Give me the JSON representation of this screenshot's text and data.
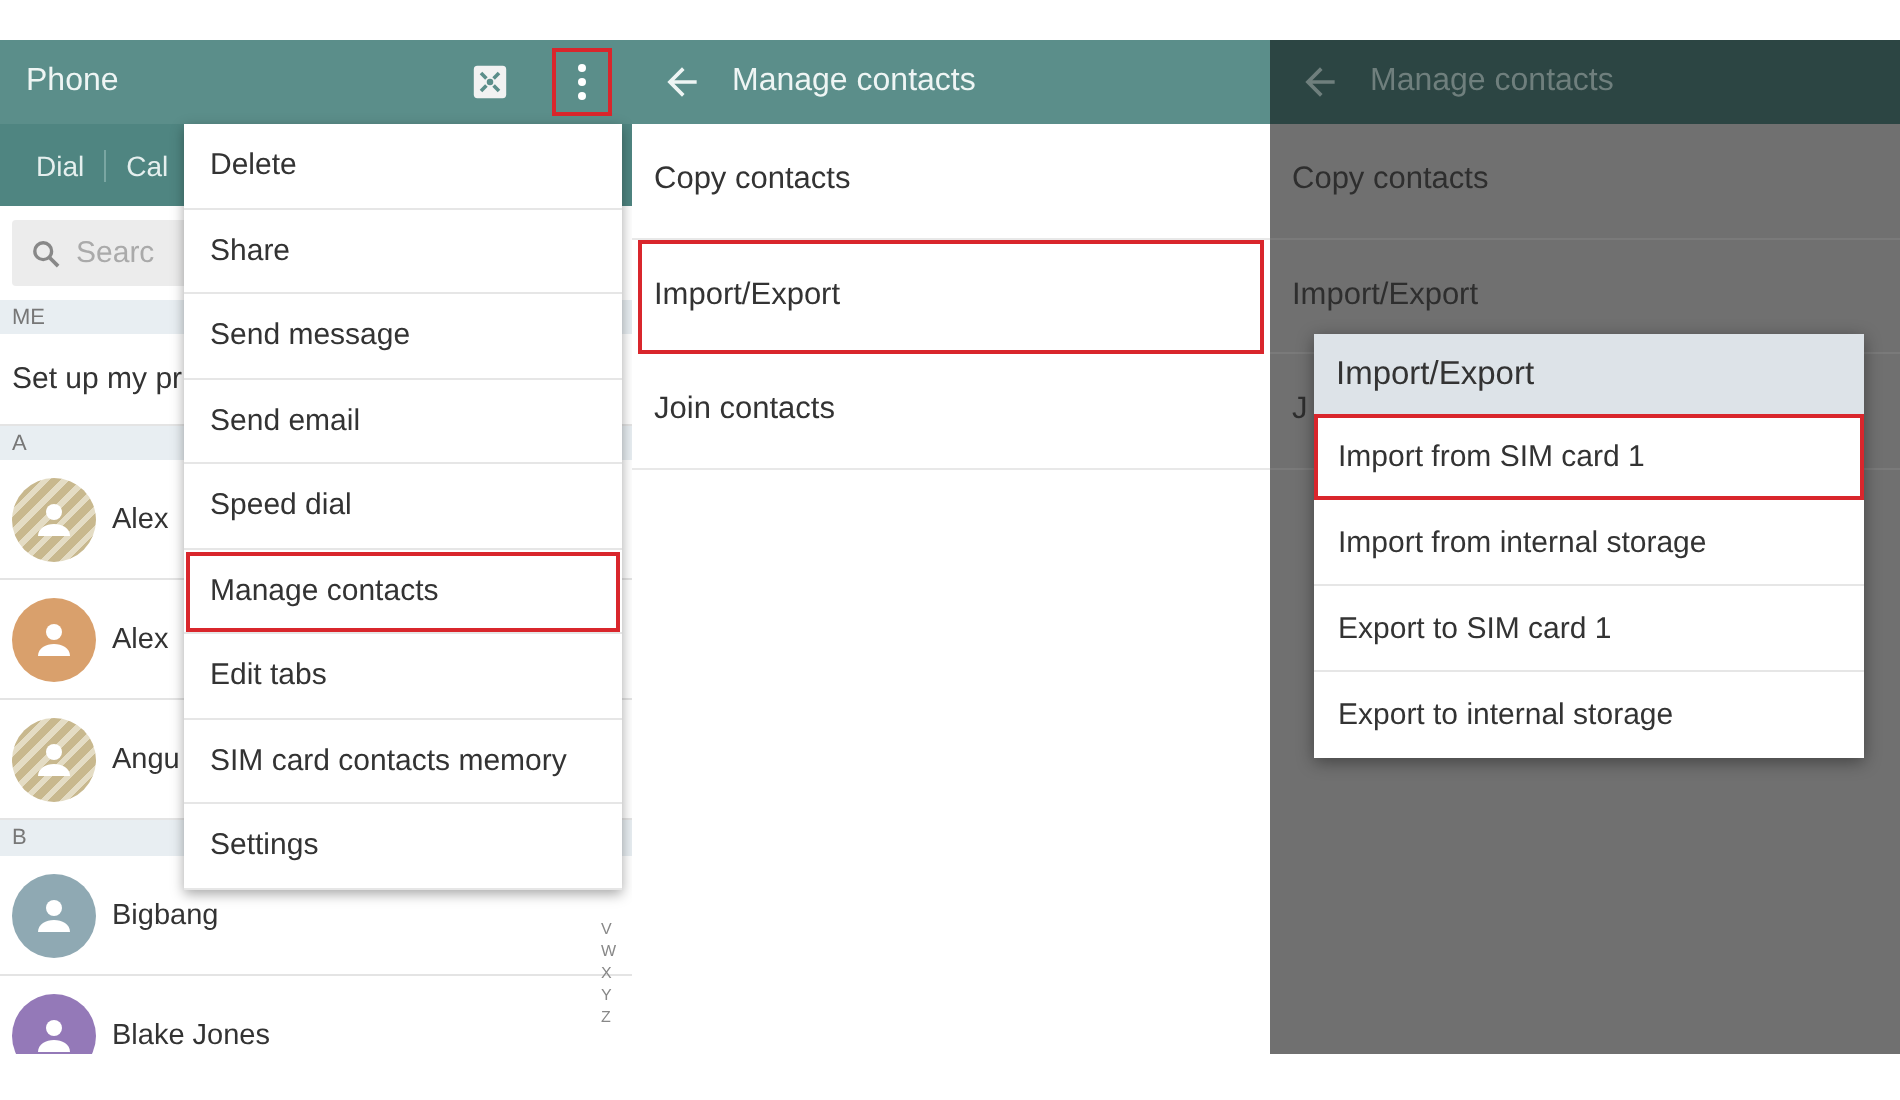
{
  "contacts_screen": {
    "title": "Phone",
    "more_button": {
      "selected": true
    },
    "tabs": [
      {
        "label": "Dial"
      },
      {
        "label": "Cal"
      }
    ],
    "search": {
      "placeholder": "Searc"
    },
    "sections": [
      {
        "header": "ME",
        "items": [
          {
            "kind": "profile",
            "name": "Set up my pr"
          }
        ]
      },
      {
        "header": "A",
        "items": [
          {
            "kind": "contact",
            "name": "Alex",
            "color": "#c8b88e",
            "striped": true
          },
          {
            "kind": "contact",
            "name": "Alex",
            "color": "#d9a06c",
            "striped": false
          },
          {
            "kind": "contact",
            "name": "Angu",
            "color": "#c8b88e",
            "striped": true
          }
        ]
      },
      {
        "header": "B",
        "items": [
          {
            "kind": "contact",
            "name": "Bigbang",
            "color": "#8fa9b3",
            "striped": false
          },
          {
            "kind": "contact",
            "name": "Blake Jones",
            "color": "#9479b8",
            "striped": false
          }
        ]
      }
    ],
    "index_letters": [
      "V",
      "W",
      "X",
      "Y",
      "Z"
    ],
    "menu": [
      {
        "label": "Delete",
        "selected": false
      },
      {
        "label": "Share",
        "selected": false
      },
      {
        "label": "Send message",
        "selected": false
      },
      {
        "label": "Send email",
        "selected": false
      },
      {
        "label": "Speed dial",
        "selected": false
      },
      {
        "label": "Manage contacts",
        "selected": true
      },
      {
        "label": "Edit tabs",
        "selected": false
      },
      {
        "label": "SIM card contacts memory",
        "selected": false
      },
      {
        "label": "Settings",
        "selected": false
      }
    ]
  },
  "manage_screen": {
    "title": "Manage contacts",
    "items": [
      {
        "label": "Copy contacts",
        "selected": false
      },
      {
        "label": "Import/Export",
        "selected": true
      },
      {
        "label": "Join contacts",
        "selected": false
      }
    ]
  },
  "dimmed_screen": {
    "title": "Manage contacts",
    "items": [
      {
        "label": "Copy contacts"
      },
      {
        "label": "Import/Export"
      },
      {
        "label": "J"
      }
    ],
    "dialog": {
      "title": "Import/Export",
      "options": [
        {
          "label": "Import from SIM card 1",
          "selected": true
        },
        {
          "label": "Import from internal storage",
          "selected": false
        },
        {
          "label": "Export to SIM card 1",
          "selected": false
        },
        {
          "label": "Export to internal storage",
          "selected": false
        }
      ]
    }
  }
}
